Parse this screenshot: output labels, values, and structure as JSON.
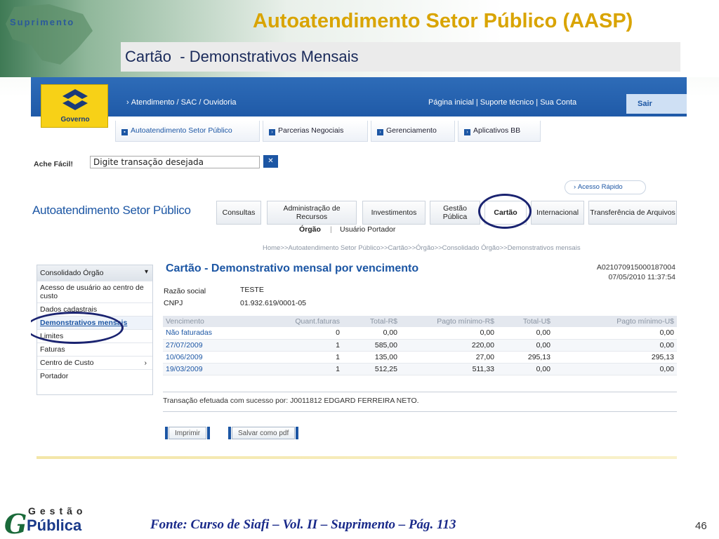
{
  "slide": {
    "brand_label": "Suprimento",
    "title": "Autoatendimento Setor Público (AASP)",
    "subtitle": "Cartão  - Demonstrativos Mensais",
    "footer_logo_top": "Gestão",
    "footer_logo_bottom": "Pública",
    "footer_source": "Fonte: Curso de Siafi – Vol. II – Suprimento – Pág. 113",
    "page_number": "46"
  },
  "header": {
    "logo_text": "Governo",
    "nav_left": "Atendimento / SAC / Ouvidoria",
    "nav_right": "Página inicial  |  Suporte técnico  |  Sua Conta",
    "logout": "Sair"
  },
  "subtabs": [
    "Autoatendimento Setor Público",
    "Parcerias Negociais",
    "Gerenciamento",
    "Aplicativos BB"
  ],
  "search": {
    "label": "Ache Fácil!",
    "value": "Digite transação desejada"
  },
  "quick_access": "Acesso Rápido",
  "app_title": "Autoatendimento Setor Público",
  "main_tabs": [
    "Consultas",
    "Administração de Recursos",
    "Investimentos",
    "Gestão Pública",
    "Cartão",
    "Internacional",
    "Transferência de Arquivos"
  ],
  "sec_tabs": [
    "Órgão",
    "Usuário Portador"
  ],
  "breadcrumb": "Home>>Autoatendimento Setor Público>>Cartão>>Órgão>>Consolidado Órgão>>Demonstrativos mensais",
  "left_menu": {
    "header": "Consolidado Órgão",
    "items": [
      "Acesso de usuário ao centro de custo",
      "Dados cadastrais",
      "Demonstrativos mensais",
      "Limites",
      "Faturas",
      "Centro de Custo",
      "Portador"
    ]
  },
  "content": {
    "title": "Cartão - Demonstrativo mensal por vencimento",
    "code": "A021070915000187004",
    "datetime": "07/05/2010 11:37:54",
    "razao_label": "Razão social",
    "razao_value": "TESTE",
    "cnpj_label": "CNPJ",
    "cnpj_value": "01.932.619/0001-05",
    "message": "Transação efetuada com sucesso por: J0011812 EDGARD FERREIRA NETO.",
    "print_label": "Imprimir",
    "pdf_label": "Salvar como pdf"
  },
  "table": {
    "headers": [
      "Vencimento",
      "Quant.faturas",
      "Total-R$",
      "Pagto mínimo-R$",
      "Total-U$",
      "Pagto mínimo-U$"
    ],
    "rows": [
      [
        "Não faturadas",
        "0",
        "0,00",
        "0,00",
        "0,00",
        "0,00"
      ],
      [
        "27/07/2009",
        "1",
        "585,00",
        "220,00",
        "0,00",
        "0,00"
      ],
      [
        "10/06/2009",
        "1",
        "135,00",
        "27,00",
        "295,13",
        "295,13"
      ],
      [
        "19/03/2009",
        "1",
        "512,25",
        "511,33",
        "0,00",
        "0,00"
      ]
    ]
  },
  "colors": {
    "accent": "#1c56a4",
    "title_gold": "#d9a400",
    "ring": "#1a2370"
  }
}
